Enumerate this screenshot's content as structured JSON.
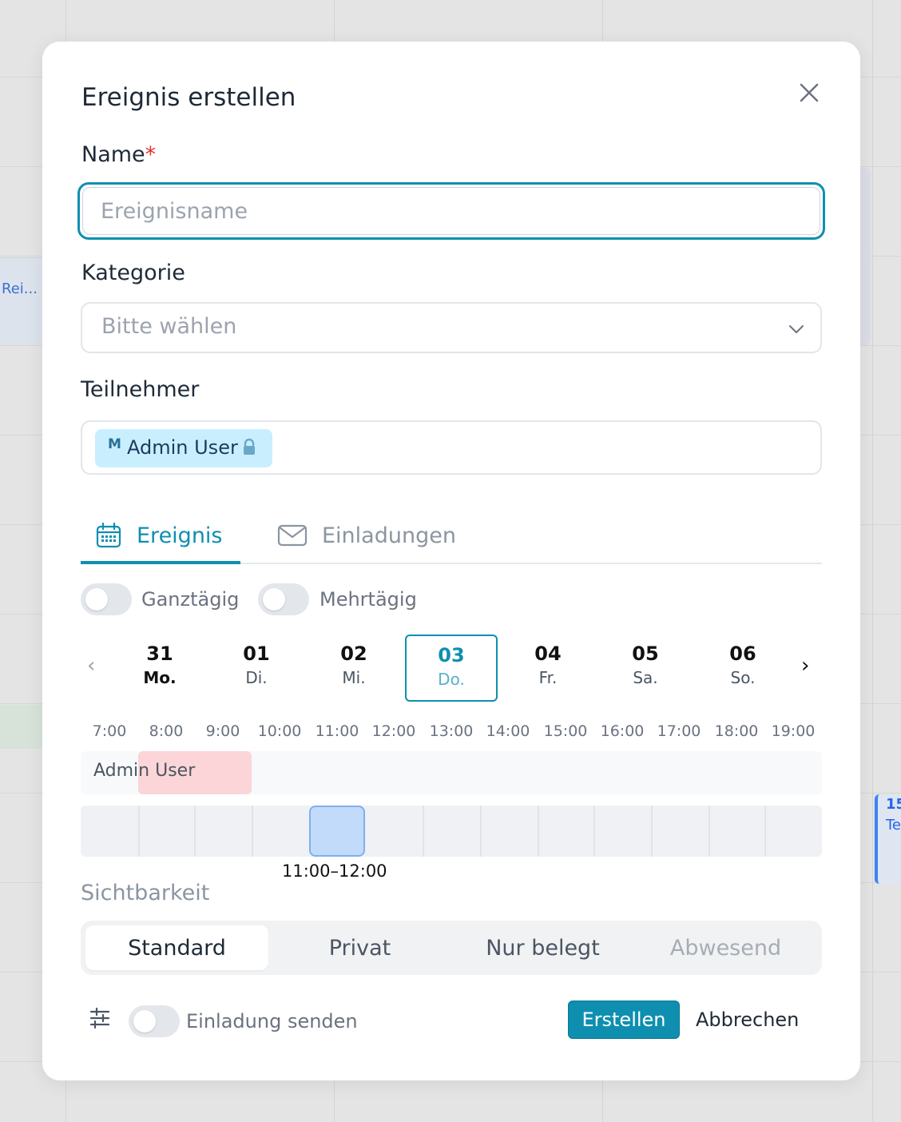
{
  "background": {
    "left_event_label": "Rei...",
    "right_event_day": "15",
    "right_event_text": "Te"
  },
  "dialog": {
    "title": "Ereignis erstellen",
    "name_label": "Name",
    "name_required_mark": "*",
    "name_placeholder": "Ereignisname",
    "category_label": "Kategorie",
    "category_placeholder": "Bitte wählen",
    "participants_label": "Teilnehmer",
    "participant_tag": {
      "initial": "M",
      "name": "Admin User"
    }
  },
  "tabs": [
    {
      "label": "Ereignis",
      "icon": "calendar-icon",
      "active": true
    },
    {
      "label": "Einladungen",
      "icon": "envelope-icon",
      "active": false
    }
  ],
  "toggles": {
    "all_day": "Ganztägig",
    "multi_day": "Mehrtägig"
  },
  "days": [
    {
      "num": "31",
      "name": "Mo."
    },
    {
      "num": "01",
      "name": "Di."
    },
    {
      "num": "02",
      "name": "Mi."
    },
    {
      "num": "03",
      "name": "Do.",
      "selected": true
    },
    {
      "num": "04",
      "name": "Fr."
    },
    {
      "num": "05",
      "name": "Sa."
    },
    {
      "num": "06",
      "name": "So."
    }
  ],
  "hours": [
    "7:00",
    "8:00",
    "9:00",
    "10:00",
    "11:00",
    "12:00",
    "13:00",
    "14:00",
    "15:00",
    "16:00",
    "17:00",
    "18:00",
    "19:00"
  ],
  "availability": {
    "user_label": "Admin User",
    "selected_range": "11:00–12:00"
  },
  "visibility": {
    "label": "Sichtbarkeit",
    "options": [
      "Standard",
      "Privat",
      "Nur belegt",
      "Abwesend"
    ],
    "selected": "Standard"
  },
  "footer": {
    "send_invite_label": "Einladung senden",
    "create_label": "Erstellen",
    "cancel_label": "Abbrechen"
  },
  "colors": {
    "accent": "#0e8fb0",
    "busy": "#fbd5d7",
    "selected_slot": "#c2dbfb",
    "tag_bg": "#c9efff",
    "required": "#e03131"
  }
}
